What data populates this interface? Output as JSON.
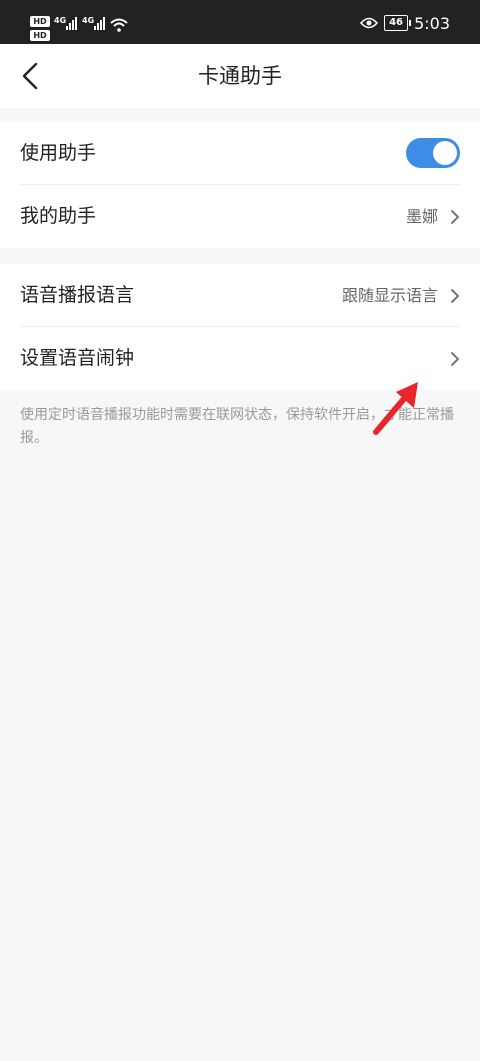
{
  "status_bar": {
    "sim1_tag": "HD",
    "sim2_tag": "HD",
    "network1": "4G",
    "network2": "4G",
    "battery": "46",
    "time": "5:03"
  },
  "nav": {
    "title": "卡通助手"
  },
  "settings": {
    "group1": [
      {
        "label": "使用助手",
        "toggle_on": true
      },
      {
        "label": "我的助手",
        "value": "墨娜"
      }
    ],
    "group2": [
      {
        "label": "语音播报语言",
        "value": "跟随显示语言"
      },
      {
        "label": "设置语音闹钟",
        "value": ""
      }
    ]
  },
  "note": "使用定时语音播报功能时需要在联网状态，保持软件开启，才能正常播报。",
  "colors": {
    "toggle_accent": "#3d8ce6",
    "annotation_arrow": "#e8242d",
    "status_bar_bg": "#222222"
  }
}
